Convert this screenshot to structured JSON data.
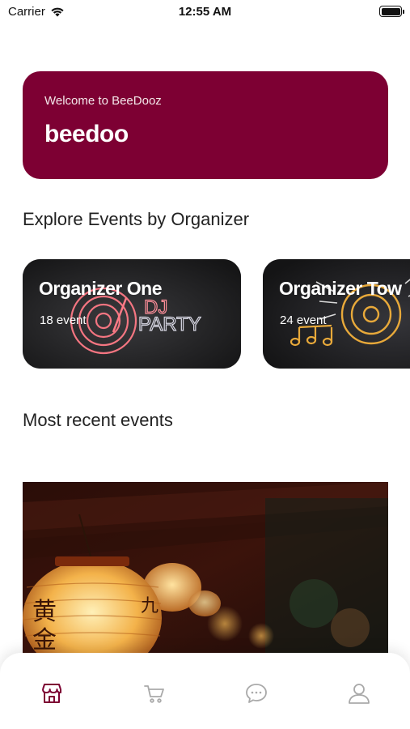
{
  "status_bar": {
    "carrier": "Carrier",
    "time": "12:55 AM"
  },
  "welcome": {
    "subtitle": "Welcome to BeeDooz",
    "username": "beedoo"
  },
  "sections": {
    "organizers_title": "Explore Events by Organizer",
    "recent_title": "Most recent events"
  },
  "organizers": [
    {
      "name": "Organizer One",
      "events": "18 event",
      "art_text_1": "DJ",
      "art_text_2": "PARTY"
    },
    {
      "name": "Organizer Tow",
      "events": "24 event"
    }
  ],
  "recent_events": [
    {
      "image_art_text_1": "黄",
      "image_art_text_2": "金",
      "image_art_text_3": "九"
    }
  ],
  "tab_bar": {
    "active": "store",
    "tabs": [
      "store-icon",
      "cart-icon",
      "chat-icon",
      "profile-icon"
    ]
  },
  "colors": {
    "brand": "#7d0033",
    "active_tab": "#7d0033",
    "inactive_tab": "#a9a9a9"
  }
}
